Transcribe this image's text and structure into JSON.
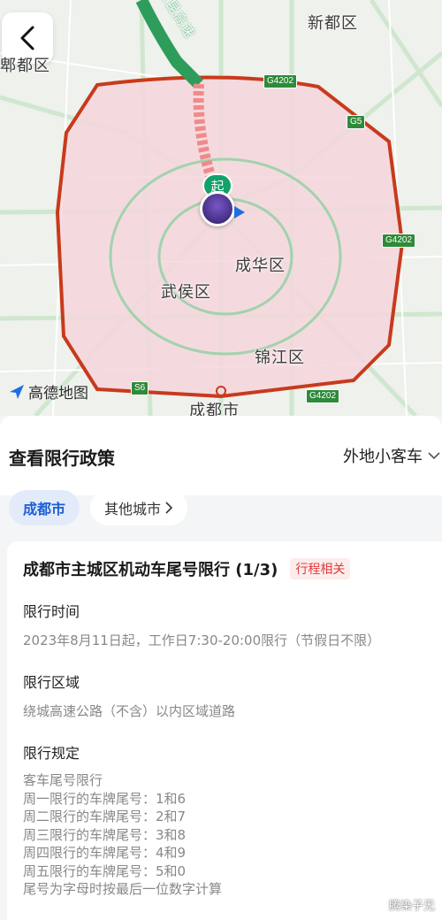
{
  "map": {
    "labels": {
      "xindu": "新都区",
      "pidu_partial": "郫都区",
      "chenghua": "成华区",
      "wuhou": "武侯区",
      "jinjiang": "锦江区",
      "chengdu_city": "成都市"
    },
    "expressway_label": "京昆高速",
    "shields": {
      "g4202_top": "G4202",
      "g5": "G5",
      "g4202_right": "G4202",
      "g4202_bottom": "G4202",
      "s6": "S6"
    },
    "start_marker": "起",
    "provider_logo": "高德地图",
    "colors": {
      "restricted_fill": "#f5d6dc",
      "ring_road": "#c83a1c",
      "route": "#2e9c5a",
      "route_restricted": "#f08a8a"
    }
  },
  "sheet": {
    "title": "查看限行政策",
    "vehicle_type": "外地小客车",
    "city_tabs": [
      "成都市",
      "其他城市"
    ],
    "active_city": "成都市"
  },
  "policy": {
    "title": "成都市主城区机动车尾号限行 (1/3)",
    "badge": "行程相关",
    "time_heading": "限行时间",
    "time_text": "2023年8月11日起，工作日7:30-20:00限行（节假日不限）",
    "area_heading": "限行区域",
    "area_text": "绕城高速公路（不含）以内区域道路",
    "rule_heading": "限行规定",
    "rules": [
      "客车尾号限行",
      "周一限行的车牌尾号：1和6",
      "周二限行的车牌尾号：2和7",
      "周三限行的车牌尾号：3和8",
      "周四限行的车牌尾号：4和9",
      "周五限行的车牌尾号：5和0",
      "尾号为字母时按最后一位数字计算"
    ]
  },
  "watermark": "腾染子无"
}
